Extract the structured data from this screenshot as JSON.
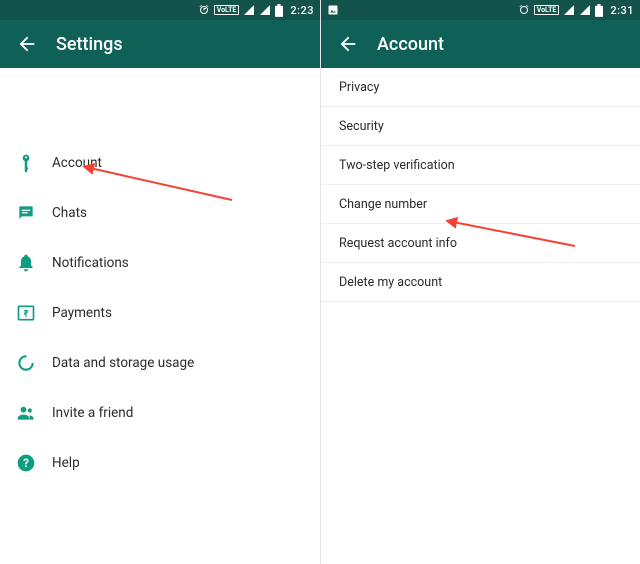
{
  "colors": {
    "primary": "#0f6157",
    "statusbar": "#14534b",
    "accent": "#128c7e",
    "icon": "#0f9d82",
    "arrow": "#f44336"
  },
  "left": {
    "status": {
      "lte": "VoLTE",
      "clock": "2:23"
    },
    "title": "Settings",
    "items": [
      {
        "id": "account",
        "label": "Account",
        "icon": "key-icon"
      },
      {
        "id": "chats",
        "label": "Chats",
        "icon": "chat-icon"
      },
      {
        "id": "notifications",
        "label": "Notifications",
        "icon": "bell-icon"
      },
      {
        "id": "payments",
        "label": "Payments",
        "icon": "rupee-icon"
      },
      {
        "id": "data",
        "label": "Data and storage usage",
        "icon": "data-icon"
      },
      {
        "id": "invite",
        "label": "Invite a friend",
        "icon": "people-icon"
      },
      {
        "id": "help",
        "label": "Help",
        "icon": "help-icon"
      }
    ]
  },
  "right": {
    "status": {
      "lte": "VoLTE",
      "clock": "2:31"
    },
    "title": "Account",
    "items": [
      {
        "id": "privacy",
        "label": "Privacy"
      },
      {
        "id": "security",
        "label": "Security"
      },
      {
        "id": "twostep",
        "label": "Two-step verification"
      },
      {
        "id": "change",
        "label": "Change number"
      },
      {
        "id": "request",
        "label": "Request account info"
      },
      {
        "id": "delete",
        "label": "Delete my account"
      }
    ]
  }
}
